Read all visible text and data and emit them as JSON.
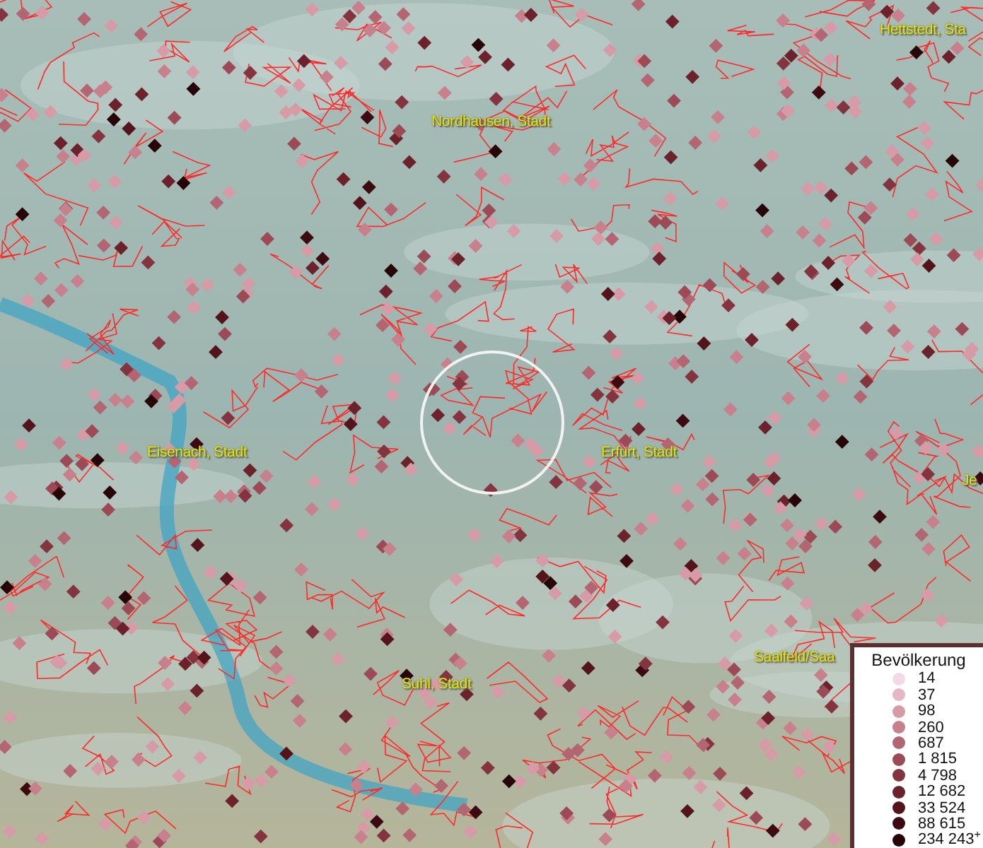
{
  "map": {
    "labels": [
      {
        "text": "Hettstedt, Sta"
      },
      {
        "text": "Nordhausen, Stadt"
      },
      {
        "text": "Eisenach, Stadt"
      },
      {
        "text": "Erfurt, Stadt"
      },
      {
        "text": "Je"
      },
      {
        "text": "Suhl, Stadt"
      },
      {
        "text": "Saalfeld/Saa"
      }
    ]
  },
  "legend": {
    "title": "Bevölkerung",
    "items": [
      {
        "label": "14",
        "color": "#f3d9e3"
      },
      {
        "label": "37",
        "color": "#e6b7c3"
      },
      {
        "label": "98",
        "color": "#d79ba7"
      },
      {
        "label": "260",
        "color": "#c7808c"
      },
      {
        "label": "687",
        "color": "#b36571"
      },
      {
        "label": "1 815",
        "color": "#9c4a55"
      },
      {
        "label": "4 798",
        "color": "#84343e"
      },
      {
        "label": "12 682",
        "color": "#6c222b"
      },
      {
        "label": "33 524",
        "color": "#54141b"
      },
      {
        "label": "88 615",
        "color": "#3c0a10"
      },
      {
        "label": "234 243$^{+}$",
        "color": "#260408"
      }
    ]
  }
}
